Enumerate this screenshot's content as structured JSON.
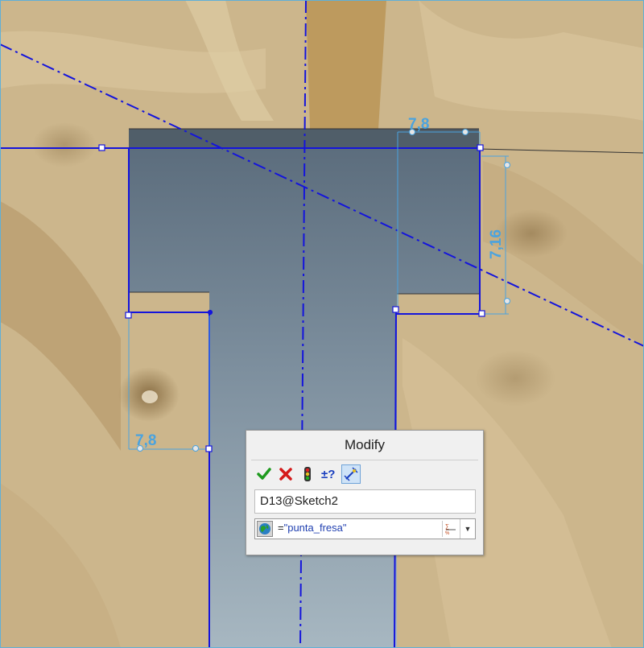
{
  "viewport": {
    "background": "osb-wood-texture",
    "dimensions": [
      {
        "name": "dim-top-right",
        "text": "7,8"
      },
      {
        "name": "dim-right-vertical",
        "text": "7,16"
      },
      {
        "name": "dim-bottom-left",
        "text": "7,8"
      }
    ],
    "colors": {
      "sketch_line": "#1010d8",
      "dimension": "#4aa3df",
      "body_top": "#5a6a78",
      "body_bottom": "#9fb0bc"
    }
  },
  "modify_dialog": {
    "title": "Modify",
    "toolbar": [
      {
        "id": "ok",
        "icon": "check-icon"
      },
      {
        "id": "cancel",
        "icon": "x-icon"
      },
      {
        "id": "rebuild",
        "icon": "traffic-light-icon"
      },
      {
        "id": "reverse",
        "icon": "plus-minus-question-icon"
      },
      {
        "id": "mark-dimension",
        "icon": "dimension-marker-icon",
        "active": true
      }
    ],
    "dimension_name": "D13@Sketch2",
    "value_prefix": "=",
    "value": "\"punta_fresa\"",
    "value_icon": "globe-icon"
  }
}
